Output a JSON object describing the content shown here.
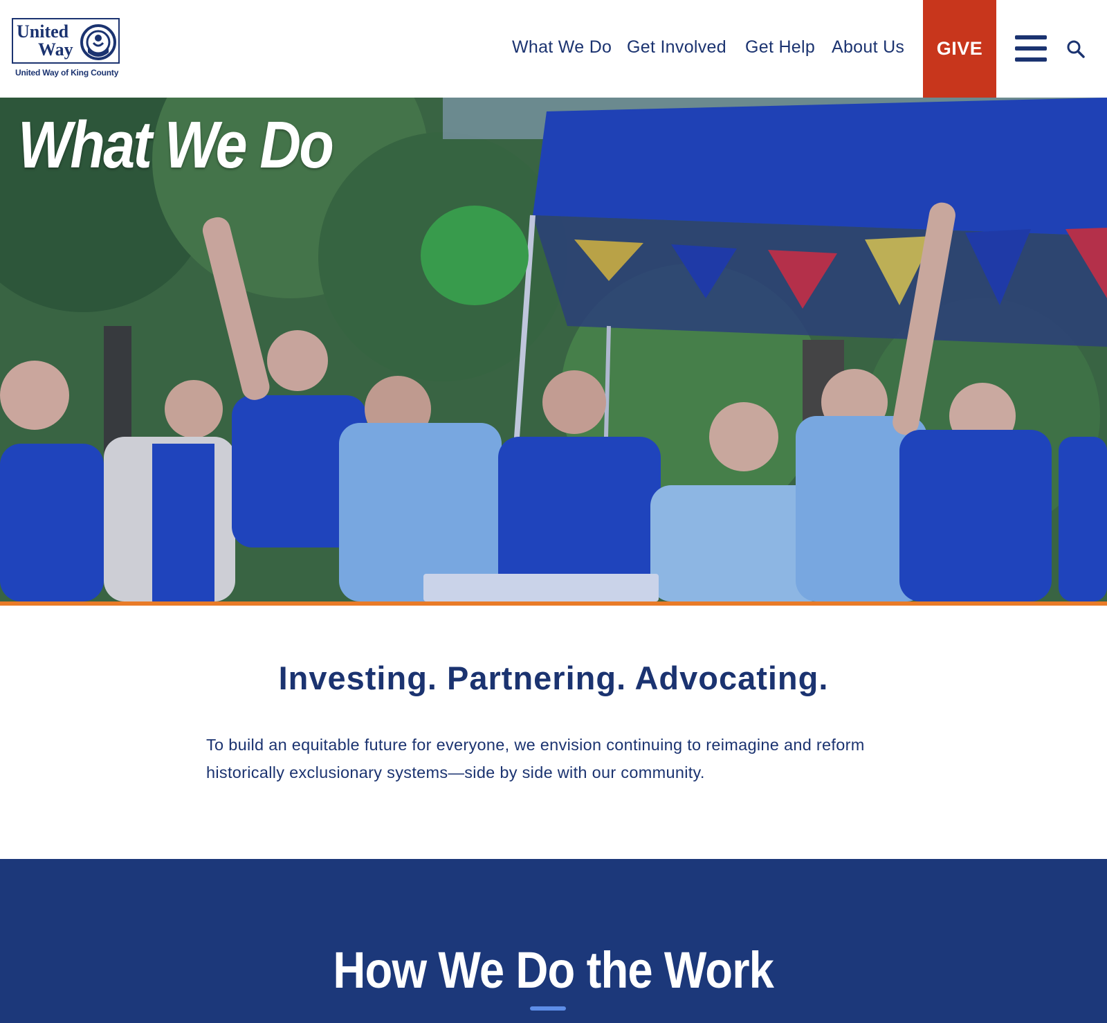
{
  "header": {
    "logo": {
      "word1": "United",
      "word2": "Way",
      "subtitle": "United Way of King County"
    },
    "nav": [
      {
        "label": "What We Do"
      },
      {
        "label": "Get Involved"
      },
      {
        "label": "Get Help"
      },
      {
        "label": "About Us"
      }
    ],
    "give_label": "GIVE",
    "icons": [
      "hamburger-menu-icon",
      "search-icon"
    ]
  },
  "hero": {
    "title": "What We Do",
    "photo": "group of volunteers in blue shirts cheering under a blue canopy tent"
  },
  "intro": {
    "heading": "Investing. Partnering. Advocating.",
    "body": "To build an equitable future for everyone, we envision continuing to reimagine and reform historically exclusionary systems—side by side with our community."
  },
  "work": {
    "heading": "How We Do the Work"
  },
  "colors": {
    "navy": "#1b3370",
    "give_red": "#c8361c",
    "hero_rule_orange": "#e97b28",
    "band_blue": "#1c387a",
    "accent_blue": "#5e8ee8"
  }
}
